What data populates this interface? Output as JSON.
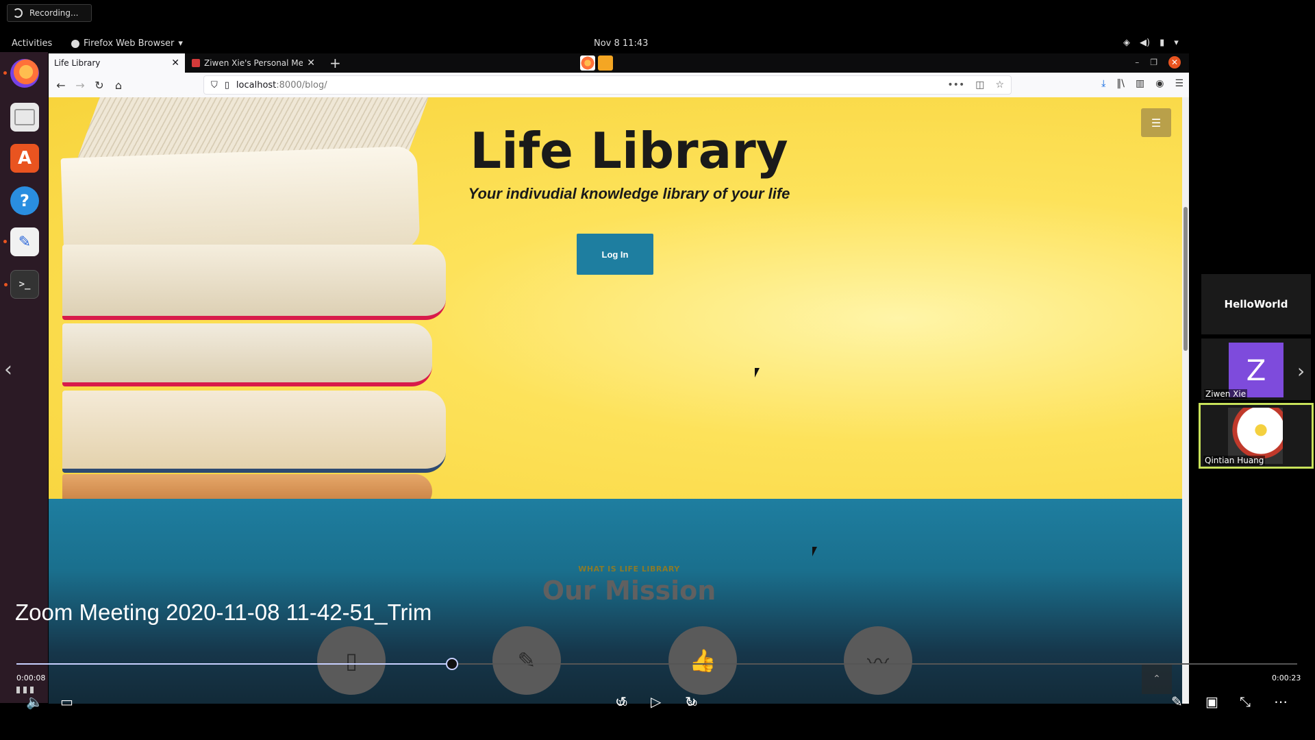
{
  "recording": {
    "label": "Recording..."
  },
  "topbar": {
    "activities": "Activities",
    "app_name": "Firefox Web Browser",
    "clock": "Nov 8  11:43"
  },
  "dock": {
    "items": [
      {
        "name": "firefox",
        "running": true
      },
      {
        "name": "files",
        "running": false
      },
      {
        "name": "ubuntu-software",
        "running": false
      },
      {
        "name": "help",
        "running": false
      },
      {
        "name": "text-editor",
        "running": true
      },
      {
        "name": "terminal",
        "running": true
      }
    ]
  },
  "browser": {
    "tabs": [
      {
        "title": "Life Library",
        "active": true
      },
      {
        "title": "Ziwen Xie's Personal Me",
        "active": false
      }
    ],
    "url": {
      "host": "localhost",
      "rest": ":8000/blog/"
    }
  },
  "page": {
    "hero": {
      "title": "Life Library",
      "subtitle": "Your indivudial knowledge library of your life",
      "login_label": "Log In",
      "menu_icon": "hamburger-icon"
    },
    "mission": {
      "kicker": "WHAT IS LIFE LIBRARY",
      "title": "Our Mission",
      "features": [
        "phone-icon",
        "pencil-icon",
        "thumbs-up-icon",
        "mustache-icon"
      ]
    }
  },
  "zoom": {
    "participants": [
      {
        "name": "HelloWorld"
      },
      {
        "name": "Ziwen Xie",
        "initial": "Z",
        "color": "#7e4bdc"
      },
      {
        "name": "Qintian Huang",
        "active_speaker": true
      }
    ]
  },
  "player": {
    "title": "Zoom Meeting 2020-11-08 11-42-51_Trim",
    "time_current": "0:00:08",
    "time_total": "0:00:23",
    "progress": 0.34,
    "skip_back": "10",
    "skip_forward": "30"
  },
  "colors": {
    "accent_teal": "#1e7ea0",
    "hero_yellow": "#fde25a",
    "ubuntu_orange": "#e95420",
    "active_speaker_border": "#c8e25a"
  }
}
